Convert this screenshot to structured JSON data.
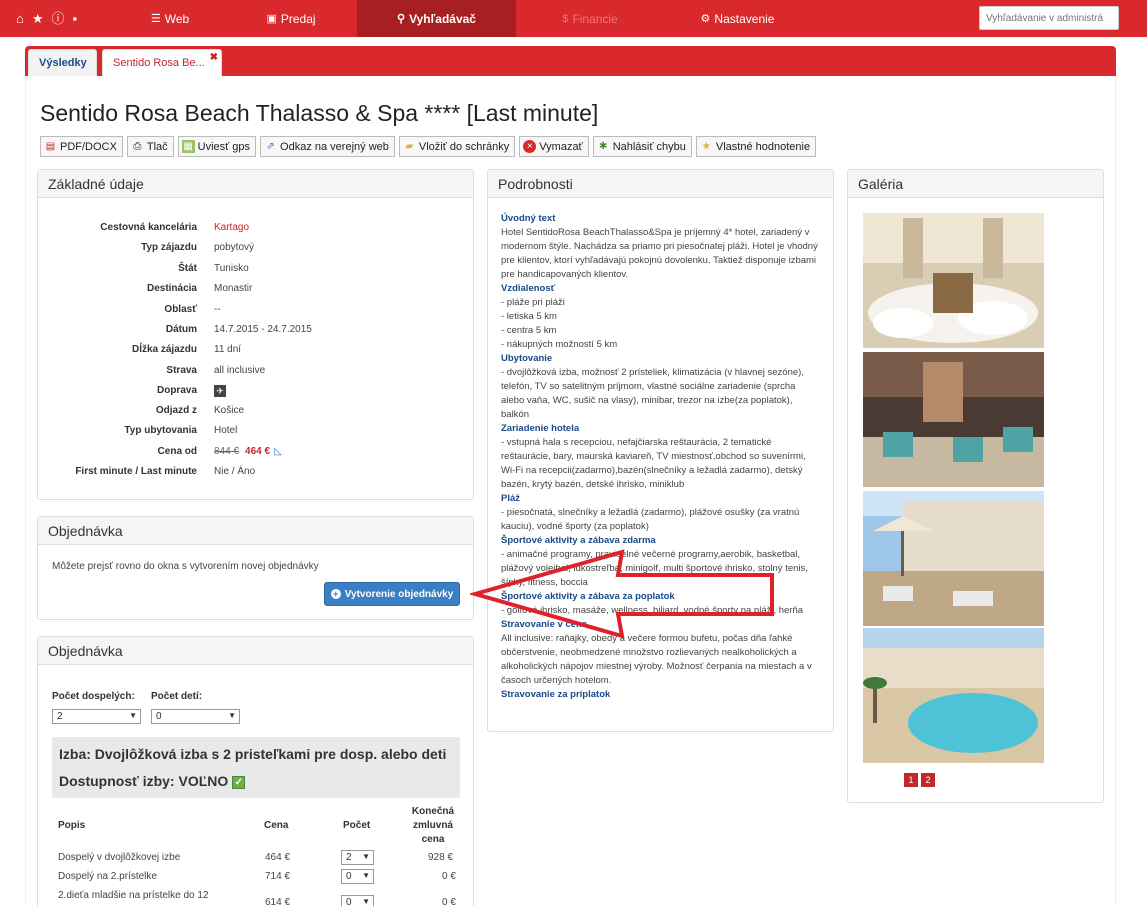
{
  "nav": {
    "web": "Web",
    "predaj": "Predaj",
    "search": "Vyhľadávač",
    "financie": "Financie",
    "settings": "Nastavenie",
    "search_placeholder": "Vyhľadávanie v administrá"
  },
  "tabs": {
    "results": "Výsledky",
    "current": "Sentido Rosa Be..."
  },
  "title": "Sentido Rosa Beach Thalasso & Spa **** [Last minute]",
  "toolbar": {
    "pdf": "PDF/DOCX",
    "print": "Tlač",
    "gps": "Uviesť gps",
    "public_link": "Odkaz na verejný web",
    "clipboard": "Vložiť do schránky",
    "delete": "Vymazať",
    "report": "Nahlásiť chybu",
    "rating": "Vlastné hodnotenie"
  },
  "basic": {
    "heading": "Základné údaje",
    "rows": [
      {
        "k": "Cestovná kancelária",
        "v": "Kartago"
      },
      {
        "k": "Typ zájazdu",
        "v": "pobytový"
      },
      {
        "k": "Štát",
        "v": "Tunisko"
      },
      {
        "k": "Destinácia",
        "v": "Monastir"
      },
      {
        "k": "Oblasť",
        "v": "--"
      },
      {
        "k": "Dátum",
        "v": "14.7.2015 - 24.7.2015"
      },
      {
        "k": "Dĺžka zájazdu",
        "v": "11 dní"
      },
      {
        "k": "Strava",
        "v": "all inclusive"
      },
      {
        "k": "Doprava",
        "v": ""
      },
      {
        "k": "Odjazd z",
        "v": "Košice"
      },
      {
        "k": "Typ ubytovania",
        "v": "Hotel"
      },
      {
        "k": "Cena od",
        "v": ""
      },
      {
        "k": "First minute / Last minute",
        "v": "Nie / Áno"
      }
    ],
    "price_old": "844 €",
    "price_new": "464 €"
  },
  "order1": {
    "heading": "Objednávka",
    "text": "Môžete prejsť rovno do okna s vytvorením novej objednávky",
    "button": "Vytvorenie objednávky"
  },
  "order2": {
    "heading": "Objednávka",
    "adults_label": "Počet dospelých:",
    "children_label": "Počet detí:",
    "adults_value": "2",
    "children_value": "0",
    "room": "Izba: Dvojlôžková izba s 2 pristeľkami pre dosp. alebo deti",
    "availability": "Dostupnosť izby: VOĽNO",
    "cols": [
      "Popis",
      "Cena",
      "Počet",
      "Konečná zmluvná cena"
    ],
    "rows": [
      {
        "desc": "Dospelý v dvojlôžkovej izbe",
        "price": "464 €",
        "count": "2",
        "total": "928 €"
      },
      {
        "desc": "Dospelý na 2.prístelke",
        "price": "714 €",
        "count": "0",
        "total": "0 €"
      },
      {
        "desc": "2.dieťa mladšie na prístelke do 12",
        "price": "614 €",
        "count": "0",
        "total": "0 €"
      }
    ]
  },
  "details": {
    "heading": "Podrobnosti",
    "sections": [
      {
        "h": "Úvodný text",
        "t": "Hotel SentidoRosa BeachThalasso&Spa je príjemný 4* hotel, zariadený v modernom štýle. Nachádza sa priamo pri piesočnatej pláži. Hotel je vhodný pre klientov, ktorí vyhľadávajú pokojnú dovolenku. Taktiež disponuje izbami pre handicapovaných klientov."
      },
      {
        "h": "Vzdialenosť",
        "t": "- pláže pri pláži\n- letiska 5 km\n- centra 5 km\n- nákupných možností 5 km"
      },
      {
        "h": "Ubytovanie",
        "t": "- dvojlôžková izba, možnosť 2 prísteliek, klimatizácia (v hlavnej sezóne), telefón, TV so satelitným príjmom, vlastné sociálne zariadenie (sprcha alebo vaňa, WC, sušič na vlasy), minibar, trezor na izbe(za poplatok), balkón"
      },
      {
        "h": "Zariadenie hotela",
        "t": "- vstupná hala s recepciou, nefajčiarska reštaurácia, 2 tematické reštaurácie, bary, maurská kaviareň, TV miestnosť,obchod so suvenírmi, Wi-Fi na recepcii(zadarmo),bazén(slnečníky a ležadlá zadarmo), detský bazén, krytý bazén, detské ihrisko, miniklub"
      },
      {
        "h": "Pláž",
        "t": "- piesočnatá, slnečníky a ležadlá (zadarmo), plážové osušky (za vratnú kauciu), vodné športy (za poplatok)"
      },
      {
        "h": "Športové aktivity a zábava zdarma",
        "t": "- animačné programy, pravidelné večerné programy,aerobik, basketbal, plážový volejbal, lukostreľba, minigolf, multi športové ihrisko, stolný tenis, šípky, fitness, boccia"
      },
      {
        "h": "Športové aktivity a zábava za poplatok",
        "t": "- golfové ihrisko, masáže, wellness, biliard, vodné športy na pláži, herňa"
      },
      {
        "h": "Stravovanie v cene",
        "t": "All inclusive: raňajky, obedy a večere formou bufetu, počas dňa ľahké občerstvenie, neobmedzené množstvo rozlievaných nealkoholických a alkoholických nápojov miestnej výroby. Možnosť čerpania na miestach a v časoch určených hotelom."
      },
      {
        "h": "Stravovanie za príplatok",
        "t": ""
      }
    ]
  },
  "gallery": {
    "heading": "Galéria",
    "pages": [
      "1",
      "2"
    ]
  }
}
